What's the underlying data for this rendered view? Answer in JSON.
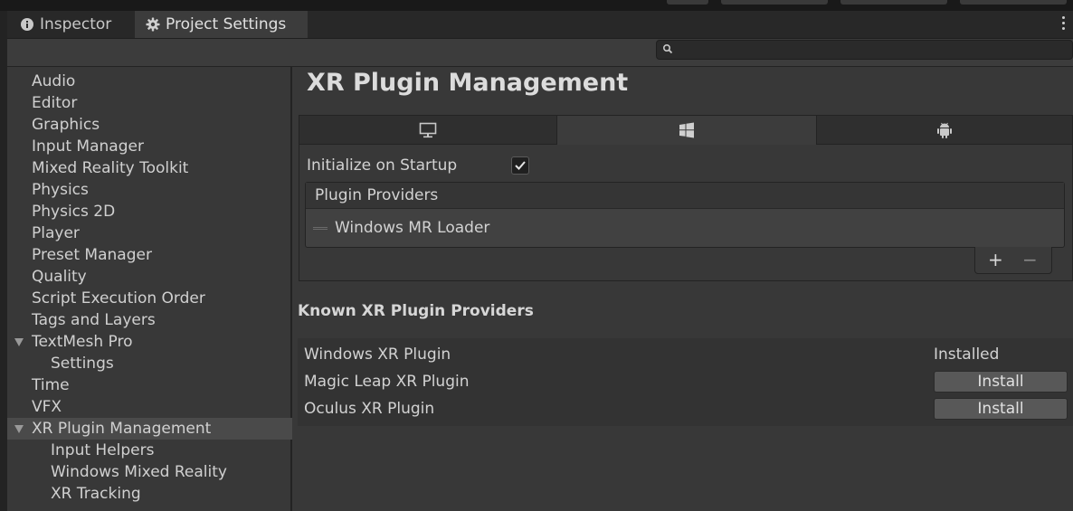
{
  "tabs": {
    "inspector": "Inspector",
    "project_settings": "Project Settings"
  },
  "search": {
    "placeholder": ""
  },
  "sidebar": {
    "items": [
      {
        "label": "Audio"
      },
      {
        "label": "Editor"
      },
      {
        "label": "Graphics"
      },
      {
        "label": "Input Manager"
      },
      {
        "label": "Mixed Reality Toolkit"
      },
      {
        "label": "Physics"
      },
      {
        "label": "Physics 2D"
      },
      {
        "label": "Player"
      },
      {
        "label": "Preset Manager"
      },
      {
        "label": "Quality"
      },
      {
        "label": "Script Execution Order"
      },
      {
        "label": "Tags and Layers"
      },
      {
        "label": "TextMesh Pro"
      },
      {
        "label": "Settings"
      },
      {
        "label": "Time"
      },
      {
        "label": "VFX"
      },
      {
        "label": "XR Plugin Management"
      },
      {
        "label": "Input Helpers"
      },
      {
        "label": "Windows Mixed Reality"
      },
      {
        "label": "XR Tracking"
      }
    ]
  },
  "main": {
    "title": "XR Plugin Management",
    "platform_tabs": [
      "desktop-icon",
      "windows-icon",
      "android-icon"
    ],
    "initialize_label": "Initialize on Startup",
    "initialize_checked": true,
    "plugin_providers_header": "Plugin Providers",
    "plugin_providers": [
      "Windows MR Loader"
    ],
    "add_symbol": "+",
    "remove_symbol": "−",
    "known_title": "Known XR Plugin Providers",
    "known_providers": [
      {
        "name": "Windows XR Plugin",
        "status": "Installed"
      },
      {
        "name": "Magic Leap XR Plugin",
        "action": "Install"
      },
      {
        "name": "Oculus XR Plugin",
        "action": "Install"
      }
    ]
  },
  "colors": {
    "background": "#383838",
    "selected_item": "#4a4a4a",
    "button": "#585858"
  }
}
